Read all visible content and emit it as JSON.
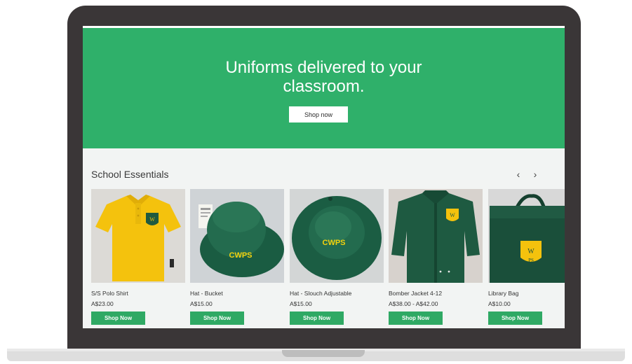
{
  "hero": {
    "title_line1": "Uniforms delivered to your",
    "title_line2": "classroom.",
    "button_label": "Shop now"
  },
  "section": {
    "title": "School Essentials",
    "prev_label": "‹",
    "next_label": "›"
  },
  "products": [
    {
      "name": "S/S Polo Shirt",
      "price": "A$23.00",
      "button": "Shop Now"
    },
    {
      "name": "Hat - Bucket",
      "price": "A$15.00",
      "button": "Shop Now",
      "embroidery": "CWPS"
    },
    {
      "name": "Hat - Slouch Adjustable",
      "price": "A$15.00",
      "button": "Shop Now",
      "embroidery": "CWPS"
    },
    {
      "name": "Bomber Jacket 4-12",
      "price": "A$38.00 - A$42.00",
      "button": "Shop Now"
    },
    {
      "name": "Library Bag",
      "price": "A$10.00",
      "button": "Shop Now"
    }
  ],
  "colors": {
    "brand_green": "#2fb06a",
    "button_green": "#2fa964",
    "uniform_yellow": "#f4c20d",
    "uniform_green": "#1f5a3f"
  }
}
